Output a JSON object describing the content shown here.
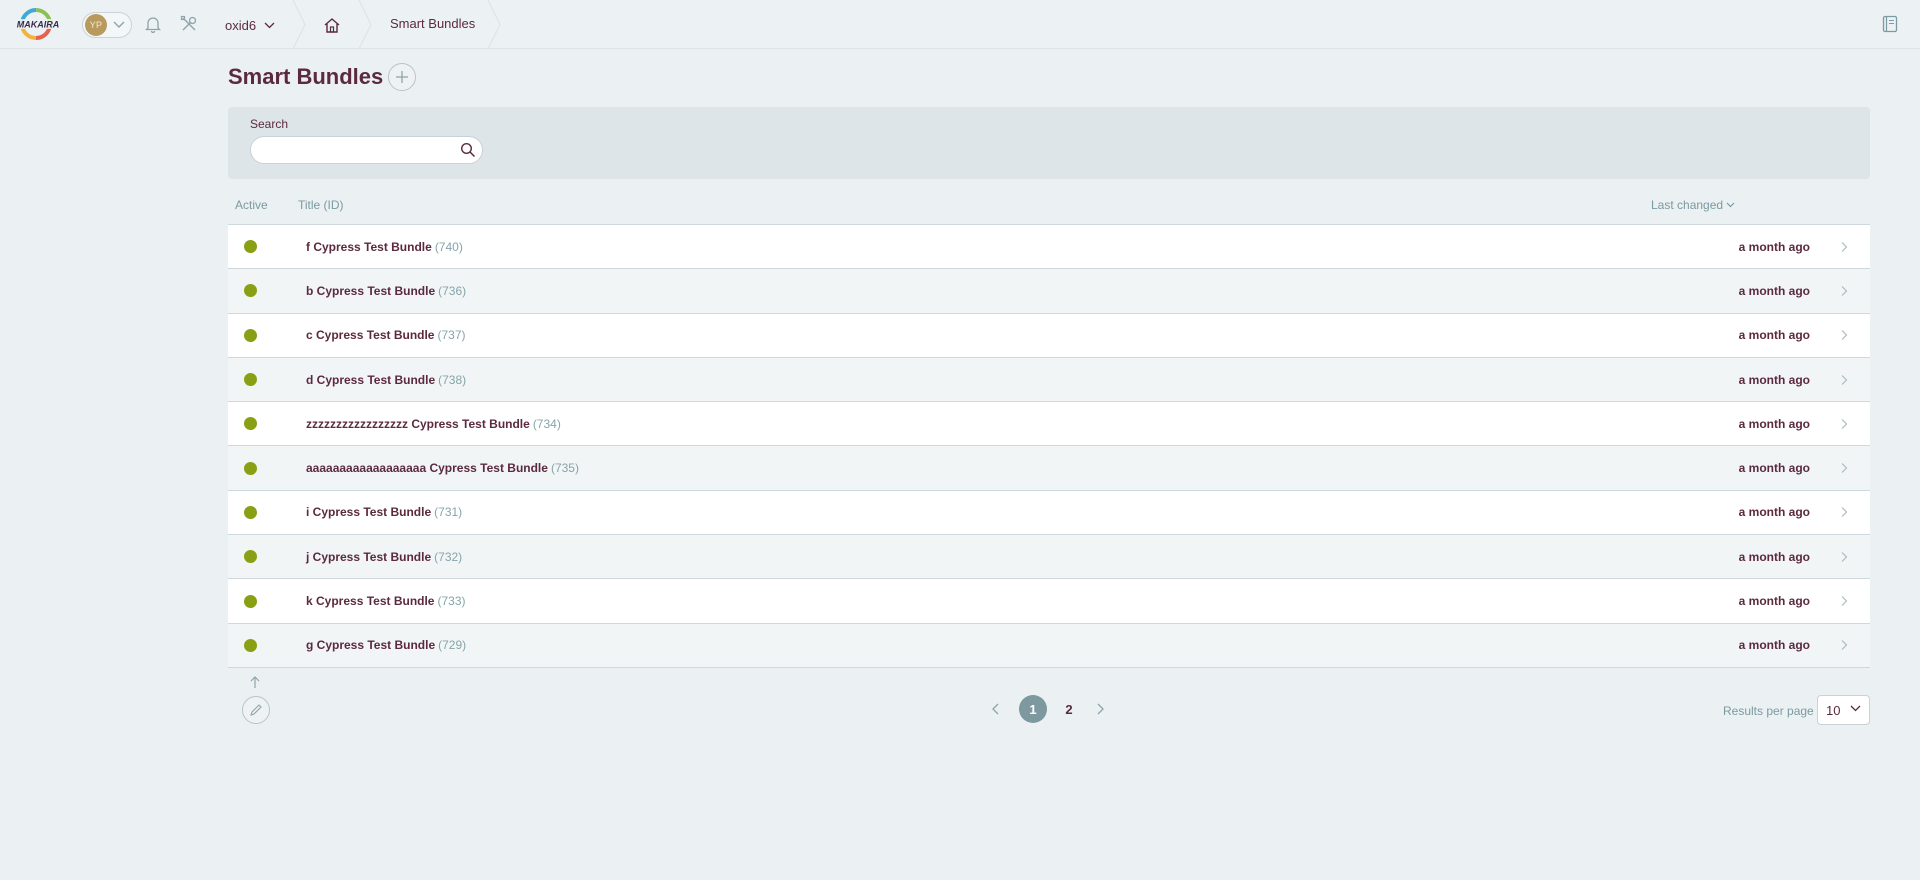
{
  "header": {
    "logo_text": "MAKAIRA",
    "user_initials": "YP",
    "shop": "oxid6",
    "breadcrumb": "Smart Bundles"
  },
  "page": {
    "title": "Smart Bundles"
  },
  "filter": {
    "search_label": "Search",
    "search_value": ""
  },
  "table": {
    "columns": {
      "active": "Active",
      "title": "Title (ID)",
      "changed": "Last changed"
    },
    "rows": [
      {
        "active": true,
        "title": "f Cypress Test Bundle",
        "id": "(740)",
        "changed": "a month ago"
      },
      {
        "active": true,
        "title": "b Cypress Test Bundle",
        "id": "(736)",
        "changed": "a month ago"
      },
      {
        "active": true,
        "title": "c Cypress Test Bundle",
        "id": "(737)",
        "changed": "a month ago"
      },
      {
        "active": true,
        "title": "d Cypress Test Bundle",
        "id": "(738)",
        "changed": "a month ago"
      },
      {
        "active": true,
        "title": "zzzzzzzzzzzzzzzzz Cypress Test Bundle",
        "id": "(734)",
        "changed": "a month ago"
      },
      {
        "active": true,
        "title": "aaaaaaaaaaaaaaaaaa Cypress Test Bundle",
        "id": "(735)",
        "changed": "a month ago"
      },
      {
        "active": true,
        "title": "i Cypress Test Bundle",
        "id": "(731)",
        "changed": "a month ago"
      },
      {
        "active": true,
        "title": "j Cypress Test Bundle",
        "id": "(732)",
        "changed": "a month ago"
      },
      {
        "active": true,
        "title": "k Cypress Test Bundle",
        "id": "(733)",
        "changed": "a month ago"
      },
      {
        "active": true,
        "title": "g Cypress Test Bundle",
        "id": "(729)",
        "changed": "a month ago"
      }
    ]
  },
  "pagination": {
    "pages": [
      "1",
      "2"
    ],
    "current": "1",
    "results_label": "Results per page",
    "per_page": "10"
  },
  "colors": {
    "active_dot": "#8aa014",
    "primary_text": "#5b2a3e",
    "muted_text": "#7b9aa2"
  }
}
